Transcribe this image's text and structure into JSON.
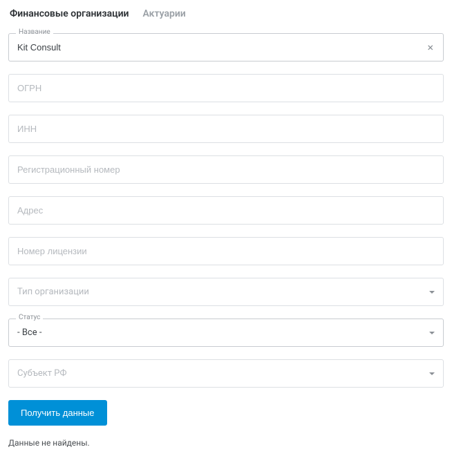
{
  "tabs": {
    "financial": "Финансовые организации",
    "actuaries": "Актуарии"
  },
  "fields": {
    "name": {
      "label": "Название",
      "value": "Kit Consult"
    },
    "ogrn": {
      "placeholder": "ОГРН"
    },
    "inn": {
      "placeholder": "ИНН"
    },
    "reg_number": {
      "placeholder": "Регистрационный номер"
    },
    "address": {
      "placeholder": "Адрес"
    },
    "license_number": {
      "placeholder": "Номер лицензии"
    },
    "org_type": {
      "placeholder": "Тип организации"
    },
    "status": {
      "label": "Статус",
      "value": "- Все -"
    },
    "region": {
      "placeholder": "Субъект РФ"
    }
  },
  "buttons": {
    "submit": "Получить данные"
  },
  "results": {
    "empty": "Данные не найдены."
  }
}
